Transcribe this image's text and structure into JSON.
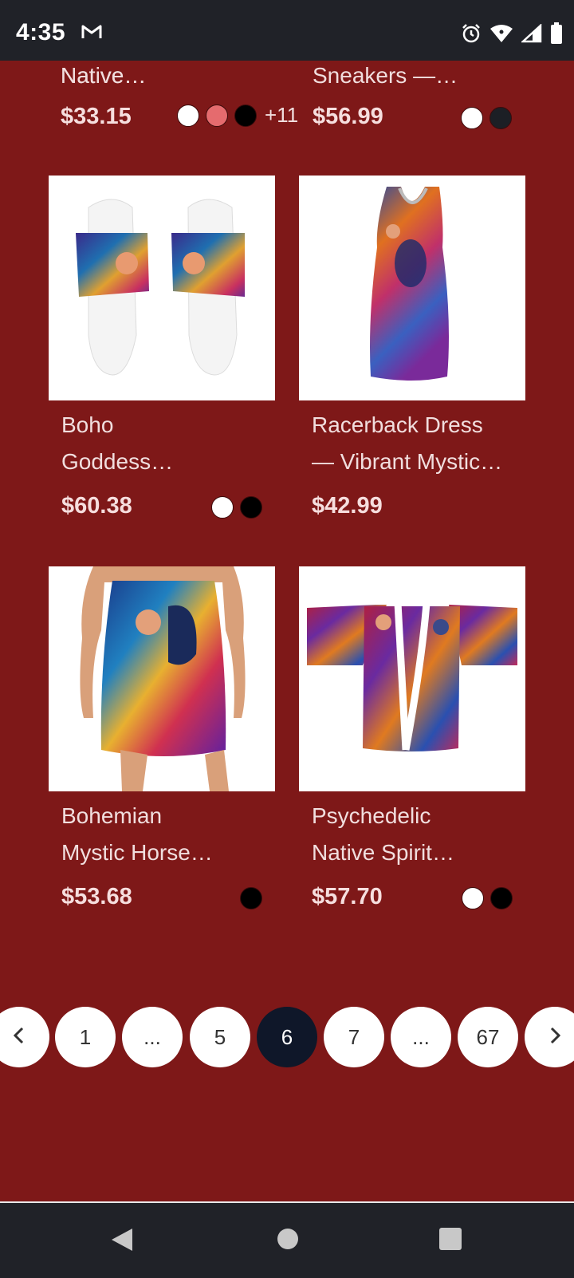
{
  "status_bar": {
    "time": "4:35"
  },
  "top_row": [
    {
      "title": "Native…",
      "price": "$33.15",
      "swatches": [
        "#ffffff",
        "#e56b6e",
        "#000000"
      ],
      "more": "+11"
    },
    {
      "title": "Sneakers —…",
      "price": "$56.99",
      "swatches": [
        "#ffffff",
        "#1c1f25"
      ],
      "more": ""
    }
  ],
  "products": [
    {
      "title_line1": "Boho",
      "title_line2": "Goddess…",
      "price": "$60.38",
      "swatches": [
        "#ffffff",
        "#000000"
      ]
    },
    {
      "title_line1": "Racerback Dress",
      "title_line2": "— Vibrant Mystic…",
      "price": "$42.99",
      "swatches": []
    },
    {
      "title_line1": "Bohemian",
      "title_line2": "Mystic Horse…",
      "price": "$53.68",
      "swatches": [
        "#000000"
      ]
    },
    {
      "title_line1": "Psychedelic",
      "title_line2": "Native Spirit…",
      "price": "$57.70",
      "swatches": [
        "#ffffff",
        "#000000"
      ]
    }
  ],
  "pagination": {
    "pages": [
      "1",
      "...",
      "5",
      "6",
      "7",
      "...",
      "67"
    ],
    "current": "6"
  }
}
